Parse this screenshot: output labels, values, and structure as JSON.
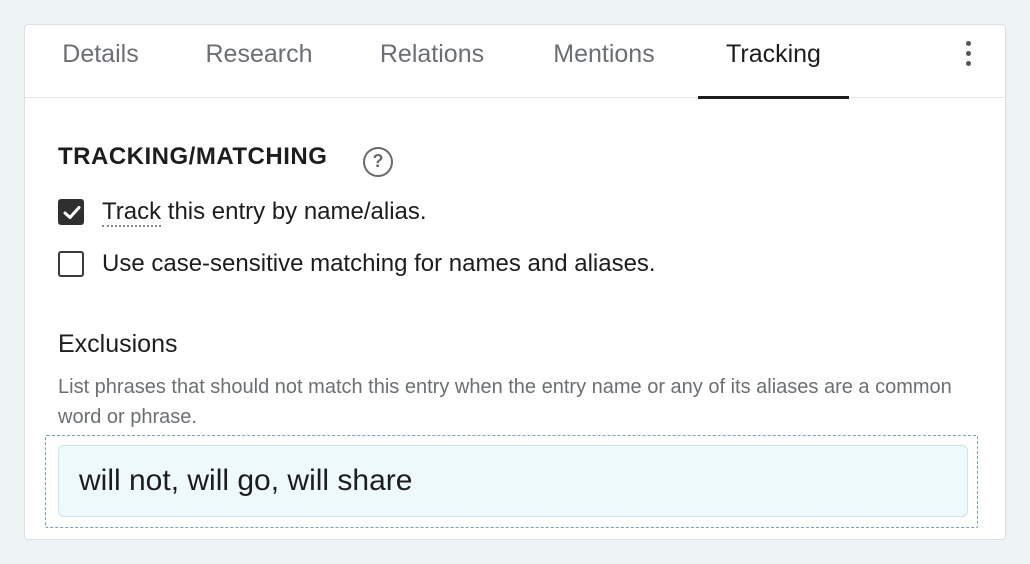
{
  "tabs": {
    "details": "Details",
    "research": "Research",
    "relations": "Relations",
    "mentions": "Mentions",
    "tracking": "Tracking",
    "active": "Tracking"
  },
  "menu_icon": "more-vertical-icon",
  "section": {
    "title": "TRACKING/MATCHING",
    "help_icon": "help-circle-icon",
    "help_glyph": "?"
  },
  "options": {
    "track": {
      "link": "Track",
      "text": " this entry by name/alias.",
      "checked": true
    },
    "case_sensitive": {
      "text": "Use case-sensitive matching for names and aliases.",
      "checked": false
    }
  },
  "exclusions": {
    "title": "Exclusions",
    "description": "List phrases that should not match this entry when the entry name or any of its aliases are a common word or phrase.",
    "value": "will not, will go, will share"
  },
  "colors": {
    "accent": "#1d1d1d",
    "input_bg": "#eef9fb",
    "dashed_border": "#7c9fb6"
  }
}
